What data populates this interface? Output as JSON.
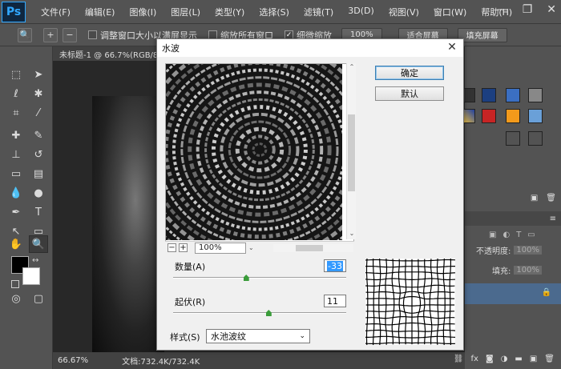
{
  "app": {
    "logo": "Ps",
    "menus": [
      "文件(F)",
      "编辑(E)",
      "图像(I)",
      "图层(L)",
      "类型(Y)",
      "选择(S)",
      "滤镜(T)",
      "3D(D)",
      "视图(V)",
      "窗口(W)",
      "帮助(H)"
    ],
    "window_controls": {
      "minimize": "—",
      "restore": "❐",
      "close": "✕"
    }
  },
  "options_bar": {
    "resize_windows": "调整窗口大小以满屏显示",
    "zoom_all_windows": "缩放所有窗口",
    "scrubby_zoom": "细微缩放",
    "scrubby_zoom_checked": true,
    "btn_100": "100%",
    "btn_fit": "适合屏幕",
    "btn_fill": "填充屏幕"
  },
  "document": {
    "tab_title": "未标题-1 @ 66.7%(RGB/8",
    "zoom": "66.67%",
    "doc_info": "文档:732.4K/732.4K"
  },
  "right_panel": {
    "opacity_label": "不透明度:",
    "opacity_value": "100%",
    "fill_label": "填充:",
    "fill_value": "100%"
  },
  "dialog": {
    "title": "水波",
    "close": "✕",
    "ok": "确定",
    "default": "默认",
    "preview_zoom": "100%",
    "amount_label": "数量(A)",
    "amount_value": "-33",
    "amount_fraction": 0.42,
    "ridges_label": "起伏(R)",
    "ridges_value": "11",
    "ridges_fraction": 0.55,
    "style_label": "样式(S)",
    "style_value": "水池波纹"
  },
  "colors": {
    "ui_bg": "#535353",
    "dialog_bg": "#f0f0f0",
    "ps_blue": "#31a8ff",
    "slider_thumb": "#3a9c3a"
  }
}
